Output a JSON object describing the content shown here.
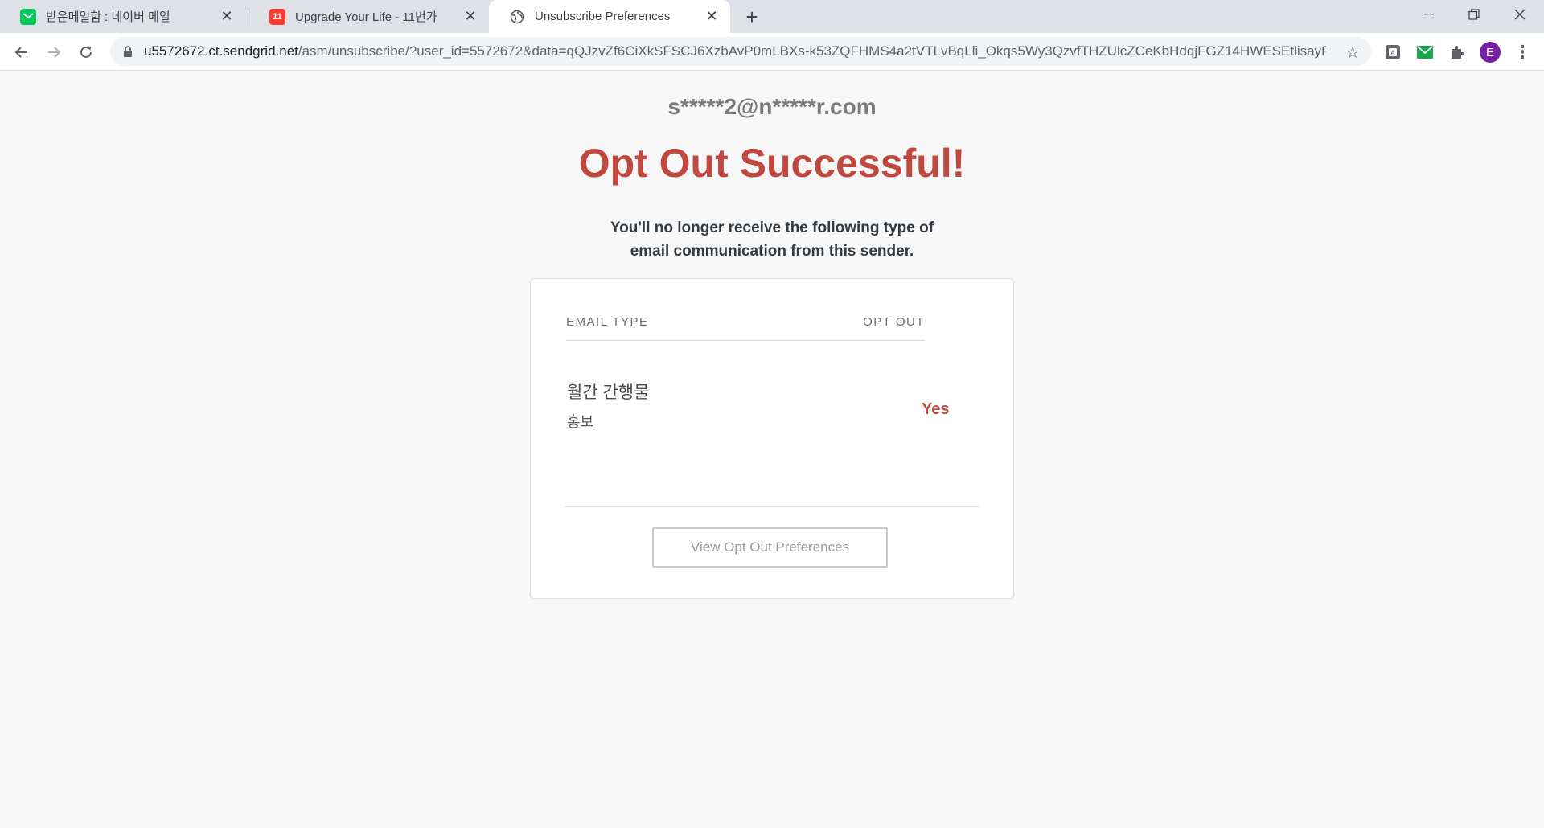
{
  "browser": {
    "tabs": [
      {
        "title": "받은메일함 : 네이버 메일",
        "favicon": "naver-mail-icon",
        "active": false
      },
      {
        "title": "Upgrade Your Life - 11번가",
        "favicon": "11st-icon",
        "active": false
      },
      {
        "title": "Unsubscribe Preferences",
        "favicon": "globe-icon",
        "active": true
      }
    ],
    "url_host": "u5572672.ct.sendgrid.net",
    "url_path": "/asm/unsubscribe/?user_id=5572672&data=qQJzvZf6CiXkSFSCJ6XzbAvP0mLBXs-k53ZQFHMS4a2tVTLvBqLli_Okqs5Wy3QzvfTHZUlcZCeKbHdqjFGZ14HWESEtlisayFT...",
    "profile_initial": "E",
    "accent_color": "#7b1fa2"
  },
  "page": {
    "email": "s*****2@n*****r.com",
    "heading": "Opt Out Successful!",
    "subtext_line1": "You'll no longer receive the following type of",
    "subtext_line2": "email communication from this sender.",
    "table": {
      "col_email_type": "EMAIL TYPE",
      "col_opt_out": "OPT OUT",
      "rows": [
        {
          "title": "월간 간행물",
          "description": "홍보",
          "opt_out": "Yes"
        }
      ]
    },
    "view_button": "View Opt Out Preferences",
    "heading_color": "#c0483e"
  }
}
